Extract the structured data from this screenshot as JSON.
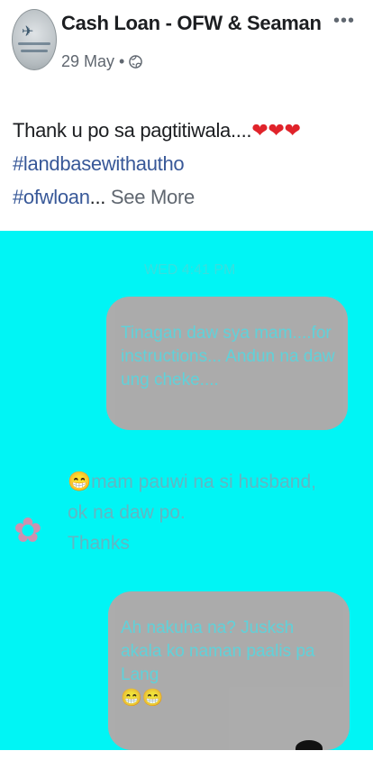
{
  "post": {
    "page_name": "Cash Loan - OFW & Seaman",
    "date": "29 May",
    "separator": "•",
    "avatar_icon": "cash-loan-logo",
    "more_icon": "more-options-icon"
  },
  "caption": {
    "line1": "Thank u po sa pagtitiwala....",
    "hearts": "❤❤❤",
    "hashtag1": "#landbasewithautho",
    "hashtag2": "#ofwloan",
    "ellipsis": "...",
    "see_more": "See More"
  },
  "image": {
    "background_color": "#00f5f5",
    "timestamp": "WED 4:41 PM",
    "bubble1_text": "Tinagan daw sya mam....for instructions... Andun na daw ung cheke....",
    "received_line1": "mam pauwi na  si husband,",
    "received_line2": "ok na daw po.",
    "received_line3": "Thanks",
    "received_emoji": "😁",
    "bubble2_text": "Ah nakuha na? Jusksh akala ko naman paalis pa Lang",
    "bubble2_emojis": "😁😁"
  },
  "colors": {
    "hashtag": "#385898",
    "heart": "#e0232a",
    "bubble": "#b5a8a8"
  }
}
